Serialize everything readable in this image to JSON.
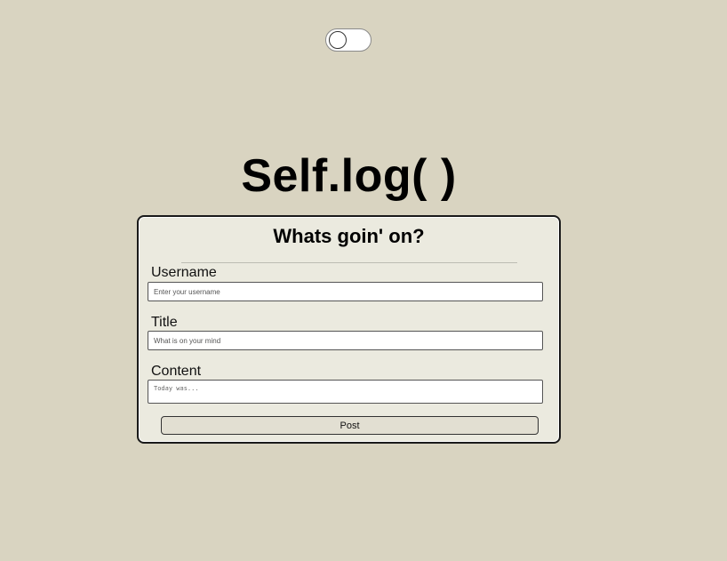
{
  "theme_toggle": {
    "state": "off"
  },
  "app": {
    "title": "Self.log( )"
  },
  "form": {
    "heading": "Whats goin' on?",
    "username": {
      "label": "Username",
      "placeholder": "Enter your username",
      "value": ""
    },
    "title": {
      "label": "Title",
      "placeholder": "What is on your mind",
      "value": ""
    },
    "content": {
      "label": "Content",
      "placeholder": "Today was...",
      "value": ""
    },
    "submit_label": "Post"
  },
  "colors": {
    "page_background": "#d9d4c1",
    "card_background": "#ebeadf",
    "button_background": "#e2dfd2"
  }
}
